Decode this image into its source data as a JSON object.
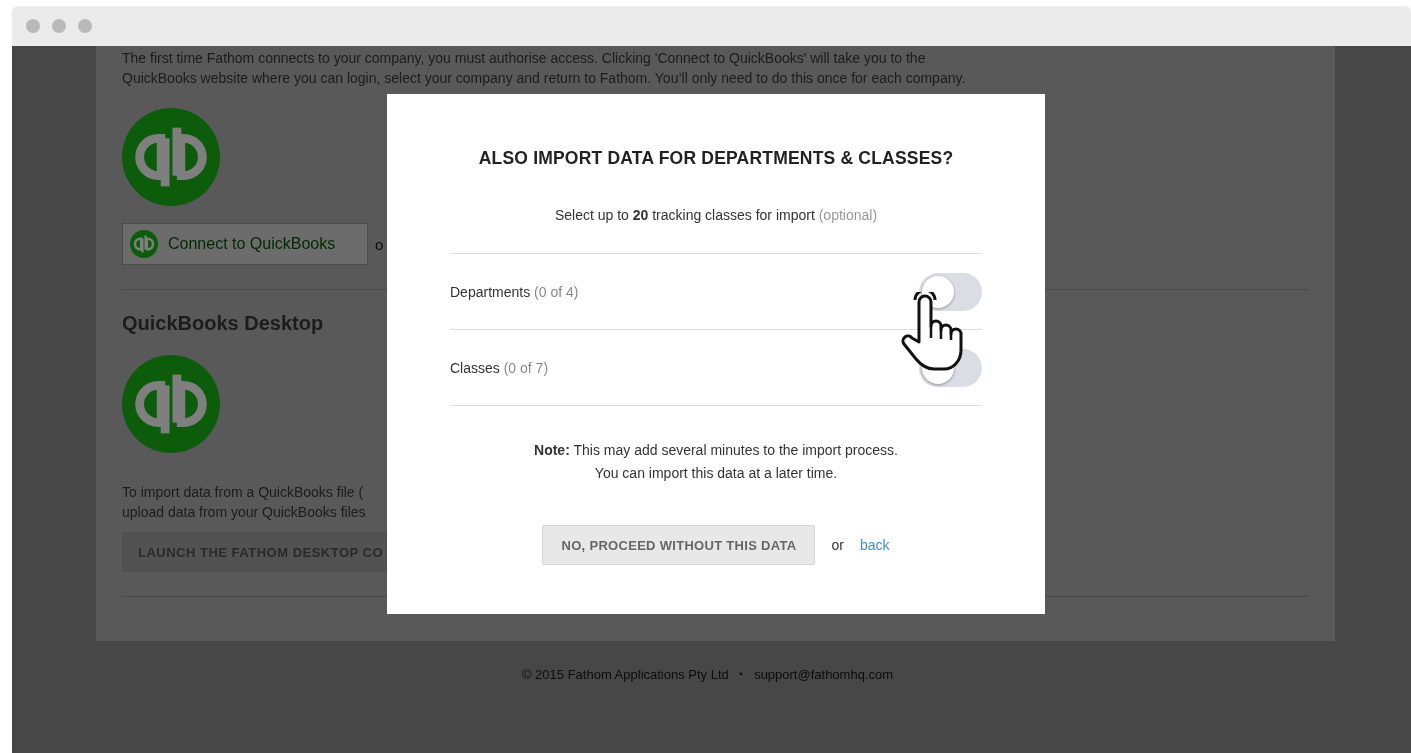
{
  "page": {
    "intro": "The first time Fathom connects to your company, you must authorise access. Clicking 'Connect to QuickBooks' will take you to the QuickBooks website where you can login, select your company and return to Fathom. You’ll only need to do this once for each company.",
    "connect_button": "Connect to QuickBooks",
    "connect_trailing": "o",
    "desktop_heading": "QuickBooks Desktop",
    "desktop_text_lines": [
      "To import data from a QuickBooks file (",
      "upload data from your QuickBooks files"
    ],
    "launch_button": "LAUNCH THE FATHOM DESKTOP CO"
  },
  "footer": {
    "copyright": "© 2015 Fathom Applications Pty Ltd",
    "separator": "·",
    "email": "support@fathomhq.com"
  },
  "modal": {
    "title": "ALSO IMPORT DATA FOR DEPARTMENTS & CLASSES?",
    "subtitle": "Select up to **20** tracking classes for import",
    "subtitle_hint": "(optional)",
    "options": [
      {
        "label": "Departments",
        "count": "(0 of 4)",
        "on": false
      },
      {
        "label": "Classes",
        "count": "(0 of 7)",
        "on": false
      }
    ],
    "note_lines": [
      "**Note:** This may add several minutes to the import process.",
      "You can import this data at a later time."
    ],
    "proceed_button": "NO, PROCEED WITHOUT THIS DATA",
    "or": "or",
    "back_link": "back"
  }
}
